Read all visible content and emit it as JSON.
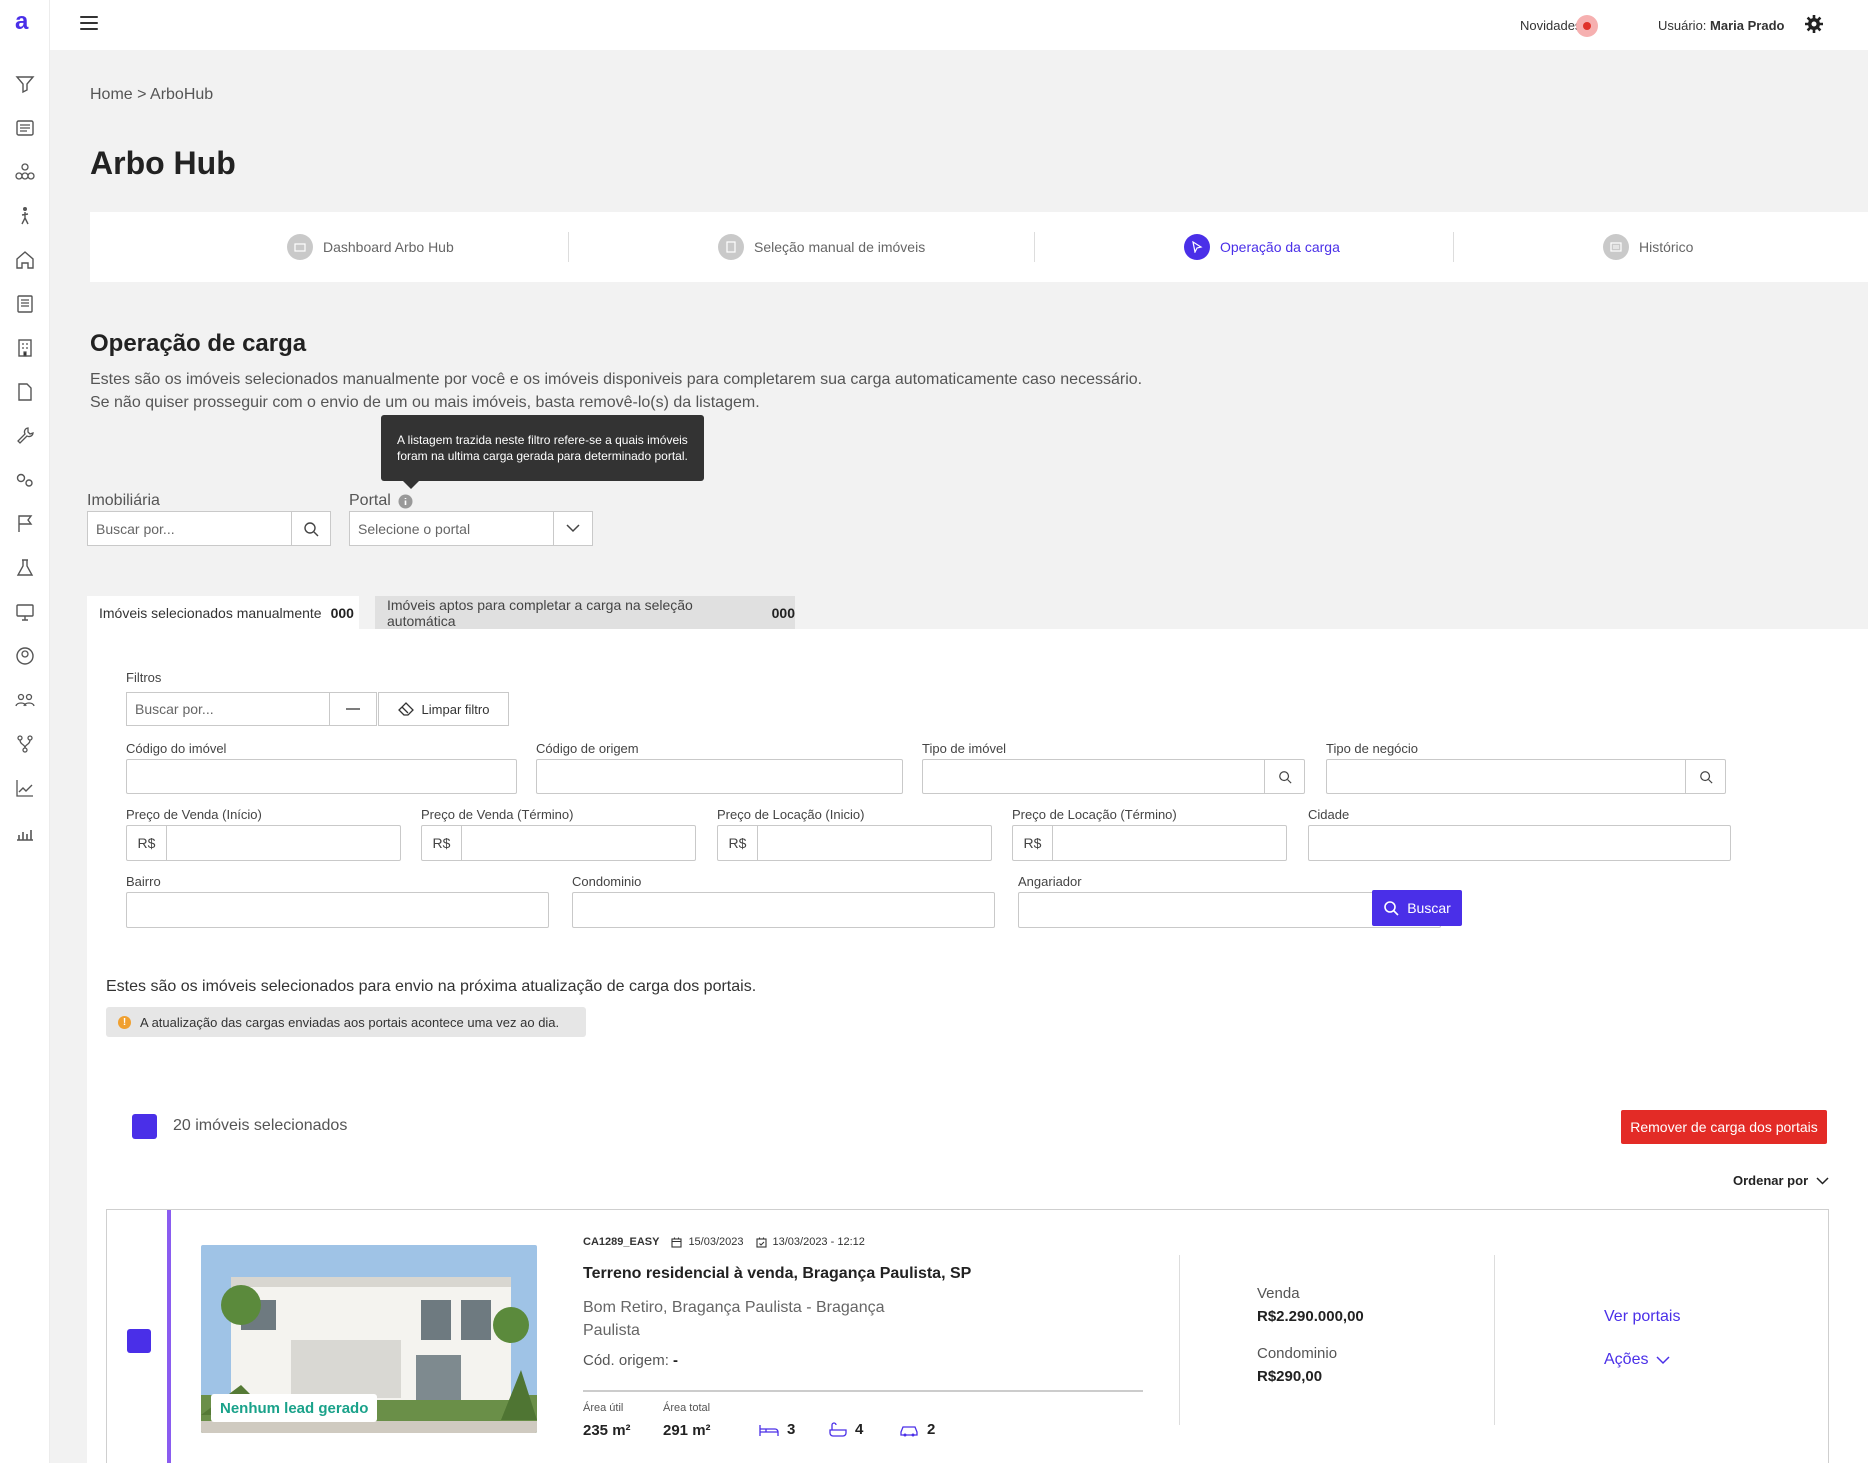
{
  "app": {
    "logo": "a"
  },
  "sidebar_icons": [
    "filter-icon",
    "list-icon",
    "network-icon",
    "person-walking-icon",
    "home-icon",
    "document-list-icon",
    "building-icon",
    "file-icon",
    "wrench-icon",
    "gears-icon",
    "flag-icon",
    "flask-icon",
    "monitor-icon",
    "user-circle-icon",
    "users-icon",
    "branch-icon",
    "chart-line-icon",
    "chart-bar-icon"
  ],
  "topbar": {
    "novidades": "Novidades",
    "usuario_label": "Usuário:",
    "usuario_name": "Maria Prado"
  },
  "breadcrumb": "Home > ArboHub",
  "page_title": "Arbo Hub",
  "steps": [
    {
      "label": "Dashboard Arbo Hub",
      "active": false
    },
    {
      "label": "Seleção manual de imóveis",
      "active": false
    },
    {
      "label": "Operação da carga",
      "active": true
    },
    {
      "label": "Histórico",
      "active": false
    }
  ],
  "section": {
    "title": "Operação de carga",
    "desc1": "Estes são os imóveis selecionados manualmente por você e os imóveis disponiveis para completarem sua carga automaticamente caso necessário.",
    "desc2": "Se não quiser prosseguir com o envio de um ou mais imóveis, basta removê-lo(s) da listagem."
  },
  "tooltip": "A listagem trazida neste filtro refere-se a quais imóveis foram na ultima carga gerada para determinado portal.",
  "imobiliaria": {
    "label": "Imobiliária",
    "placeholder": "Buscar por..."
  },
  "portal": {
    "label": "Portal",
    "placeholder": "Selecione o portal"
  },
  "tabs": [
    {
      "label": "Imóveis selecionados manualmente",
      "count": "000"
    },
    {
      "label": "Imóveis aptos para completar a carga na seleção automática",
      "count": "000"
    }
  ],
  "filters": {
    "label": "Filtros",
    "search_placeholder": "Buscar por...",
    "clear_label": "Limpar filtro",
    "codigo_imovel": "Código do imóvel",
    "codigo_origem": "Código de origem",
    "tipo_imovel": "Tipo de imóvel",
    "tipo_negocio": "Tipo de negócio",
    "preco_venda_inicio": "Preço de Venda (Início)",
    "preco_venda_termino": "Preço de Venda (Término)",
    "preco_locacao_inicio": "Preço de Locação (Inicio)",
    "preco_locacao_termino": "Preço de Locação (Término)",
    "cidade": "Cidade",
    "bairro": "Bairro",
    "condominio": "Condominio",
    "angariador": "Angariador",
    "currency": "R$",
    "buscar": "Buscar"
  },
  "info": {
    "text": "Estes são os imóveis selecionados para envio na próxima atualização de carga dos portais.",
    "notice": "A atualização das cargas enviadas aos portais acontece uma vez ao dia.",
    "notice_icon": "!"
  },
  "selection": {
    "count_label": "20 imóveis selecionados",
    "remove_label": "Remover de carga dos portais",
    "sort_label": "Ordenar por"
  },
  "property": {
    "code": "CA1289_EASY",
    "date_created": "15/03/2023",
    "date_updated": "13/03/2023 - 12:12",
    "title": "Terreno residencial à venda, Bragança Paulista, SP",
    "address": "Bom Retiro, Bragança Paulista - Bragança Paulista",
    "origin_label": "Cód. origem:",
    "origin_value": "-",
    "lead_badge": "Nenhum lead gerado",
    "area_util_label": "Área útil",
    "area_util": "235 m²",
    "area_total_label": "Área total",
    "area_total": "291 m²",
    "bedrooms": "3",
    "bathrooms": "4",
    "parking": "2",
    "venda_label": "Venda",
    "venda_value": "R$2.290.000,00",
    "condominio_label": "Condominio",
    "condominio_value": "R$290,00",
    "ver_portais": "Ver portais",
    "acoes": "Ações"
  },
  "colors": {
    "accent": "#4a2fe8",
    "danger": "#e32b26",
    "badge": "#1aa28a"
  }
}
